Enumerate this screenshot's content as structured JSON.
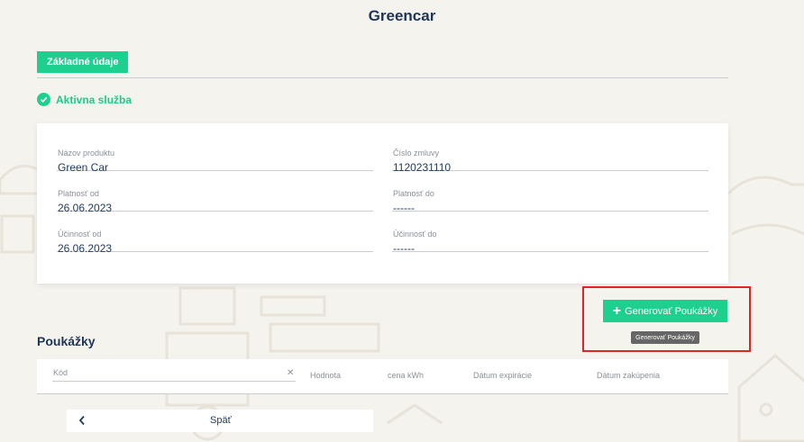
{
  "header": {
    "title": "Greencar"
  },
  "tabs": [
    {
      "label": "Základné údaje",
      "active": true
    }
  ],
  "status": {
    "label": "Aktivna služba",
    "icon": "check-circle-icon",
    "color": "#1ed090"
  },
  "details": {
    "product_name": {
      "label": "Názov produktu",
      "value": "Green Car"
    },
    "contract_number": {
      "label": "Číslo zmluvy",
      "value": "1120231110"
    },
    "valid_from": {
      "label": "Platnosť od",
      "value": "26.06.2023"
    },
    "valid_to": {
      "label": "Platnosť do",
      "value": "------"
    },
    "effective_from": {
      "label": "Účinnosť od",
      "value": "26.06.2023"
    },
    "effective_to": {
      "label": "Účinnosť do",
      "value": "------"
    }
  },
  "actions": {
    "generate_label": "Generovať Poukážky",
    "generate_tooltip": "Generovať Poukážky"
  },
  "vouchers": {
    "title": "Poukážky",
    "search_placeholder": "Kód",
    "columns": [
      "Hodnota",
      "cena kWh",
      "Dátum expirácie",
      "Dátum zakúpenia"
    ]
  },
  "footer": {
    "back_label": "Späť"
  },
  "colors": {
    "accent": "#1ed090",
    "highlight": "#e32424",
    "heading": "#1d3557"
  }
}
